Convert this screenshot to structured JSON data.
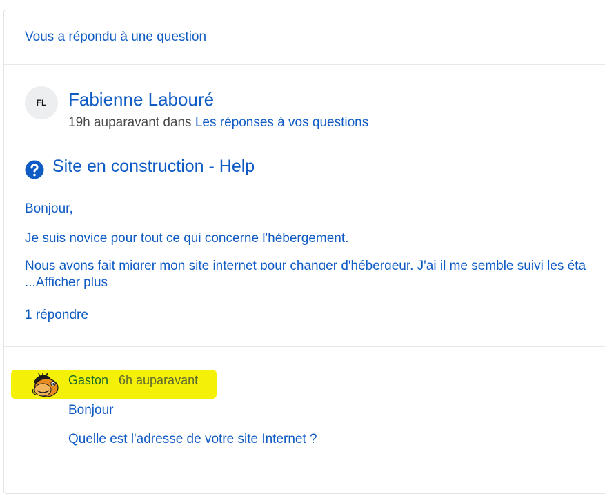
{
  "notification": {
    "header": "Vous a répondu à une question"
  },
  "post": {
    "author_initials": "FL",
    "author_name": "Fabienne Labouré",
    "time": "19h auparavant dans",
    "community": "Les réponses à vos questions",
    "icon": "question-circle-icon",
    "title": "Site en construction - Help",
    "body": [
      "Bonjour,",
      "Je suis novice pour tout ce qui concerne l'hébergement.",
      "Nous avons fait migrer mon site internet pour changer d'hébergeur. J'ai il me semble suivi les éta"
    ],
    "show_more": "...Afficher plus",
    "reply_count": "1 répondre"
  },
  "reply": {
    "author": "Gaston",
    "time": "6h auparavant",
    "lines": [
      "Bonjour",
      "Quelle est l'adresse de votre site Internet ?"
    ]
  },
  "colors": {
    "link": "#0f5bc4",
    "highlight": "#f5f007"
  }
}
